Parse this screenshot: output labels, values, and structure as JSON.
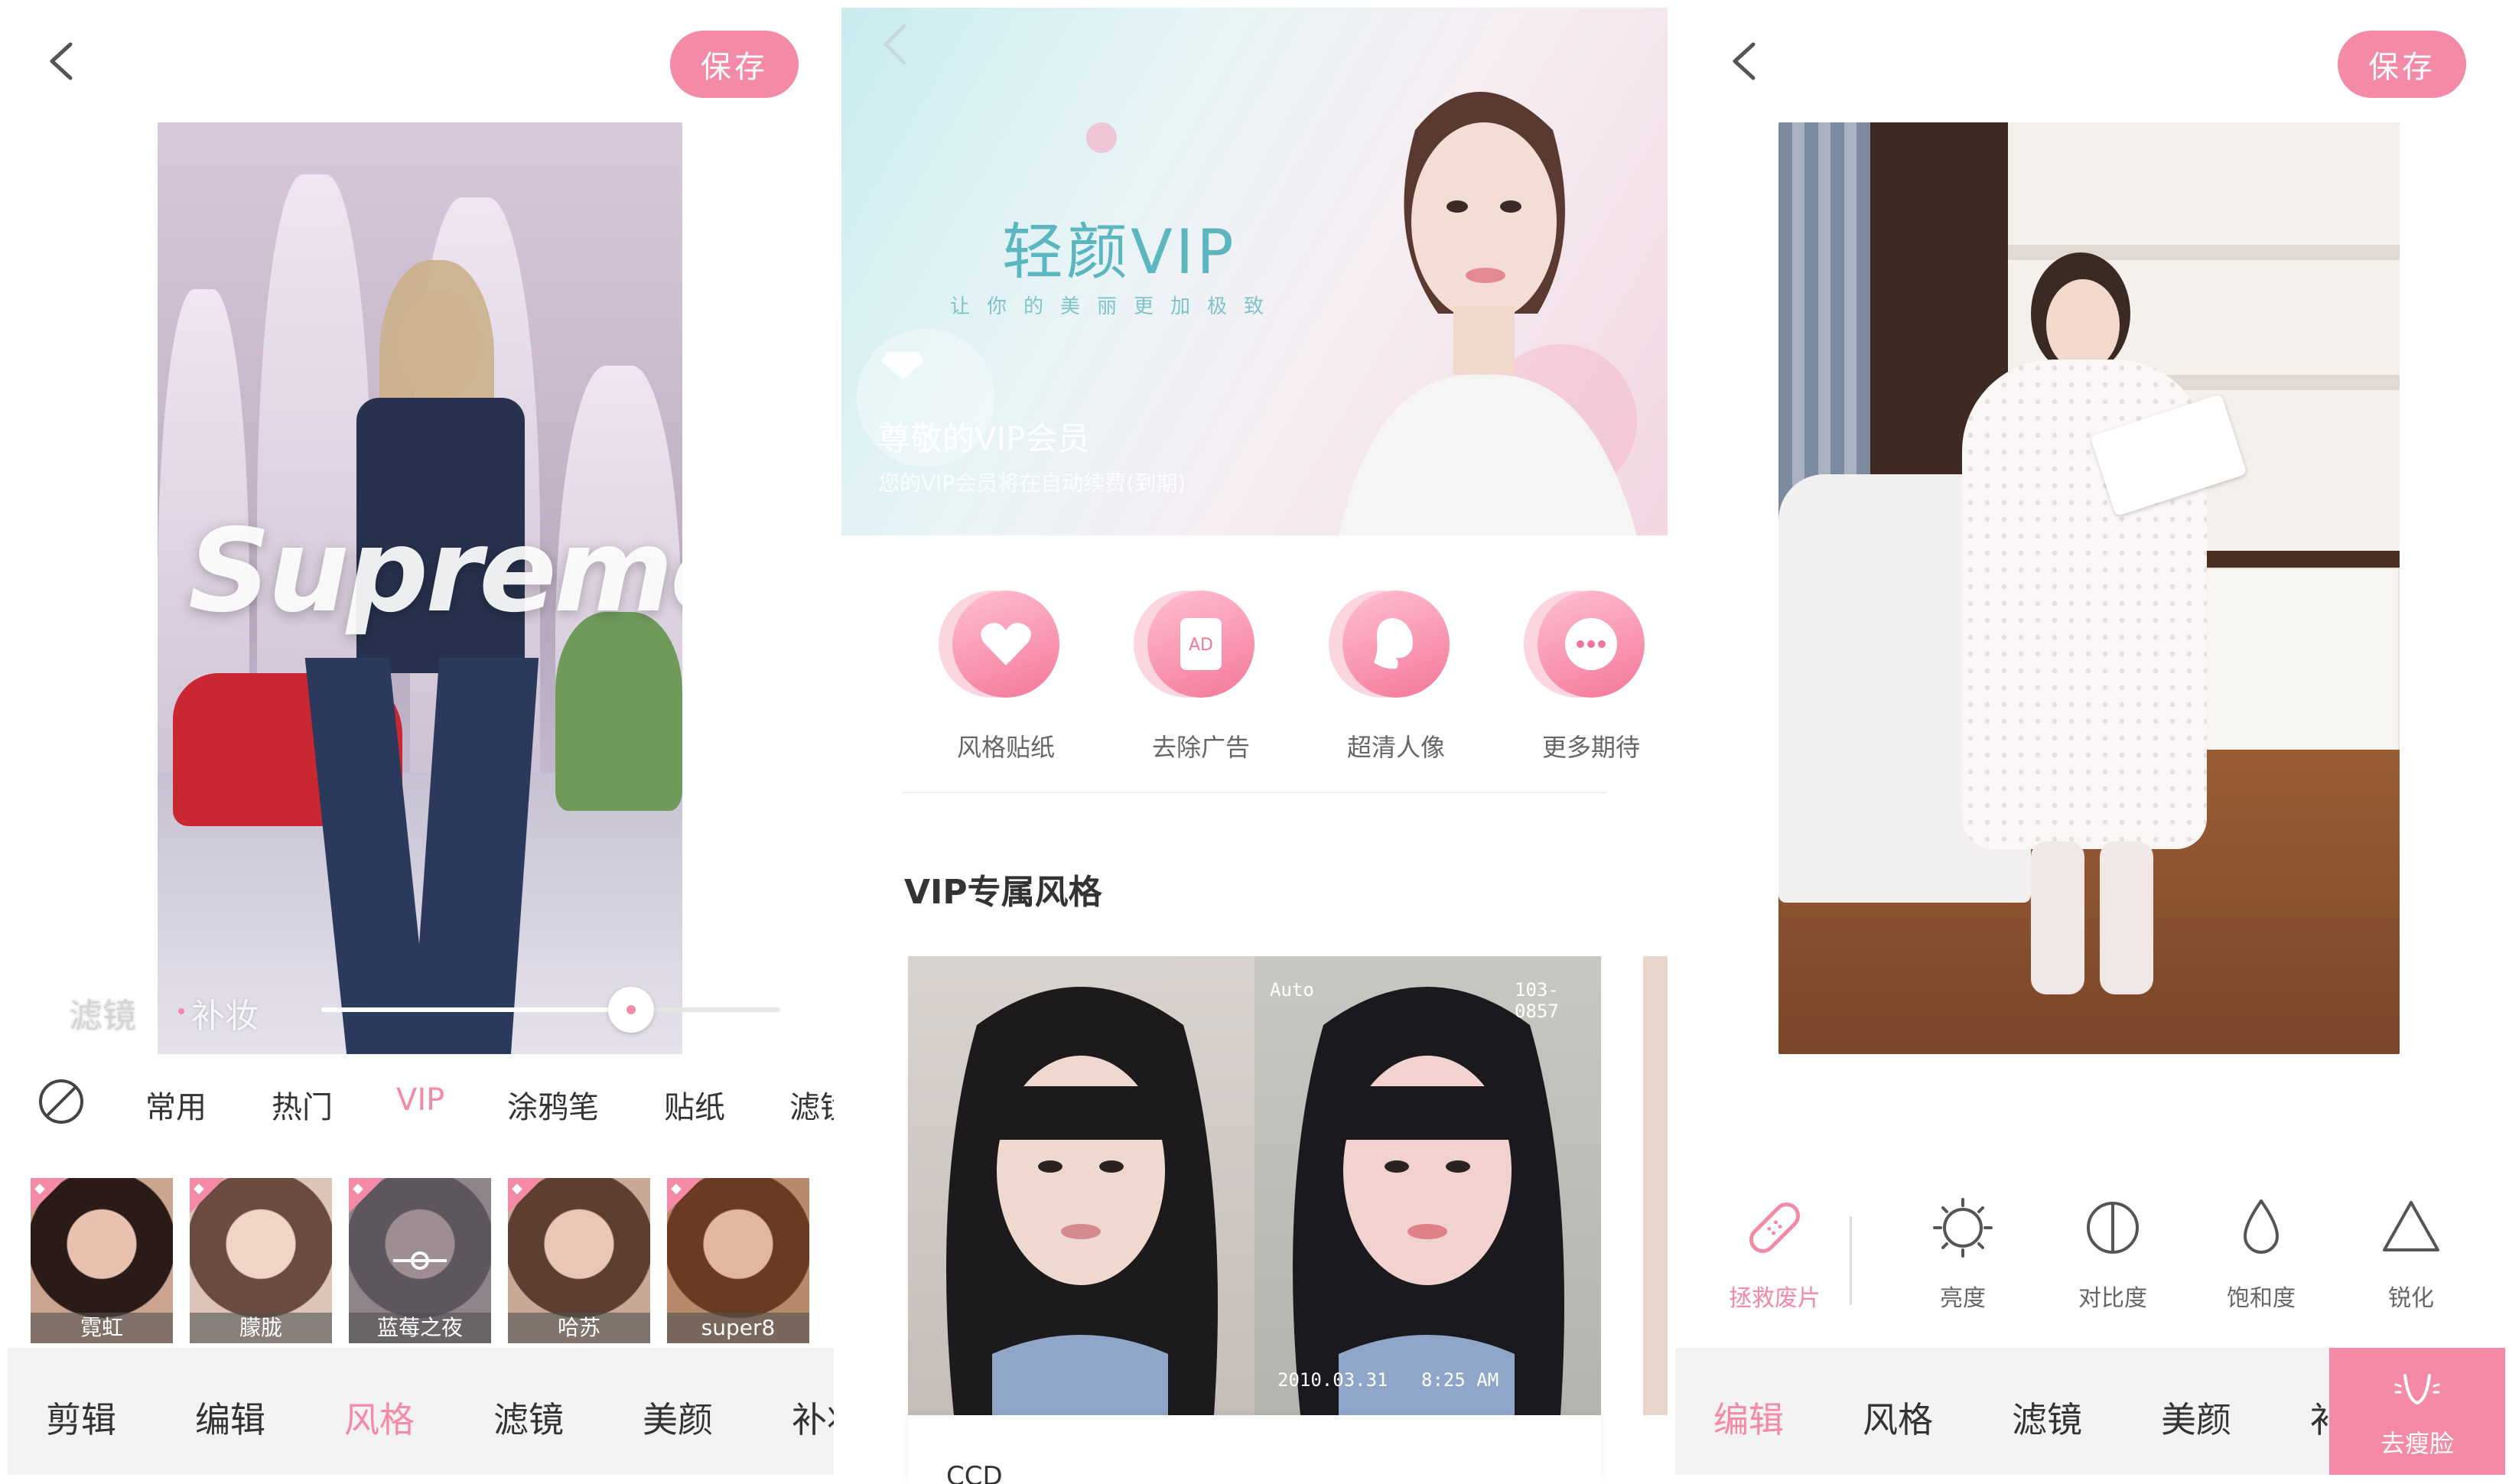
{
  "panel1": {
    "save_label": "保存",
    "watermark": "Supreme",
    "slider_tabs": [
      "滤镜",
      "补妆"
    ],
    "slider_value": 0.6,
    "categories": [
      "常用",
      "热门",
      "VIP",
      "涂鸦笔",
      "贴纸",
      "滤镜"
    ],
    "active_category": "VIP",
    "stickers": [
      {
        "label": "霓虹"
      },
      {
        "label": "朦胧"
      },
      {
        "label": "蓝莓之夜"
      },
      {
        "label": "哈苏"
      },
      {
        "label": "super8"
      }
    ],
    "bottom_tabs": [
      "剪辑",
      "编辑",
      "风格",
      "滤镜",
      "美颜",
      "补妆"
    ],
    "active_tab": "风格"
  },
  "panel2": {
    "banner": {
      "title": "轻颜VIP",
      "subtitle": "让你的美丽更加极致",
      "member_title": "尊敬的VIP会员",
      "member_note": "您的VIP会员将在自动续费(到期)"
    },
    "features": [
      {
        "label": "风格贴纸",
        "icon": "heart-icon"
      },
      {
        "label": "去除广告",
        "icon": "ad-icon"
      },
      {
        "label": "超清人像",
        "icon": "portrait-icon"
      },
      {
        "label": "更多期待",
        "icon": "more-icon"
      }
    ],
    "section_title": "VIP专属风格",
    "card": {
      "cam_mode": "Auto",
      "cam_counter": "103-0857",
      "date": "2010.03.31",
      "time": "8:25 AM",
      "caption": "CCD"
    }
  },
  "panel3": {
    "save_label": "保存",
    "tools": [
      {
        "label": "拯救废片",
        "icon": "bandage-icon"
      },
      {
        "label": "亮度",
        "icon": "brightness-icon"
      },
      {
        "label": "对比度",
        "icon": "contrast-icon"
      },
      {
        "label": "饱和度",
        "icon": "saturation-icon"
      },
      {
        "label": "锐化",
        "icon": "sharpen-icon"
      }
    ],
    "active_tool": "拯救废片",
    "bottom_tabs": [
      "编辑",
      "风格",
      "滤镜",
      "美颜",
      "补妆"
    ],
    "active_tab": "编辑",
    "slim_button": "去瘦脸"
  },
  "colors": {
    "accent": "#f58aa6",
    "text": "#333333",
    "muted": "#666666"
  }
}
